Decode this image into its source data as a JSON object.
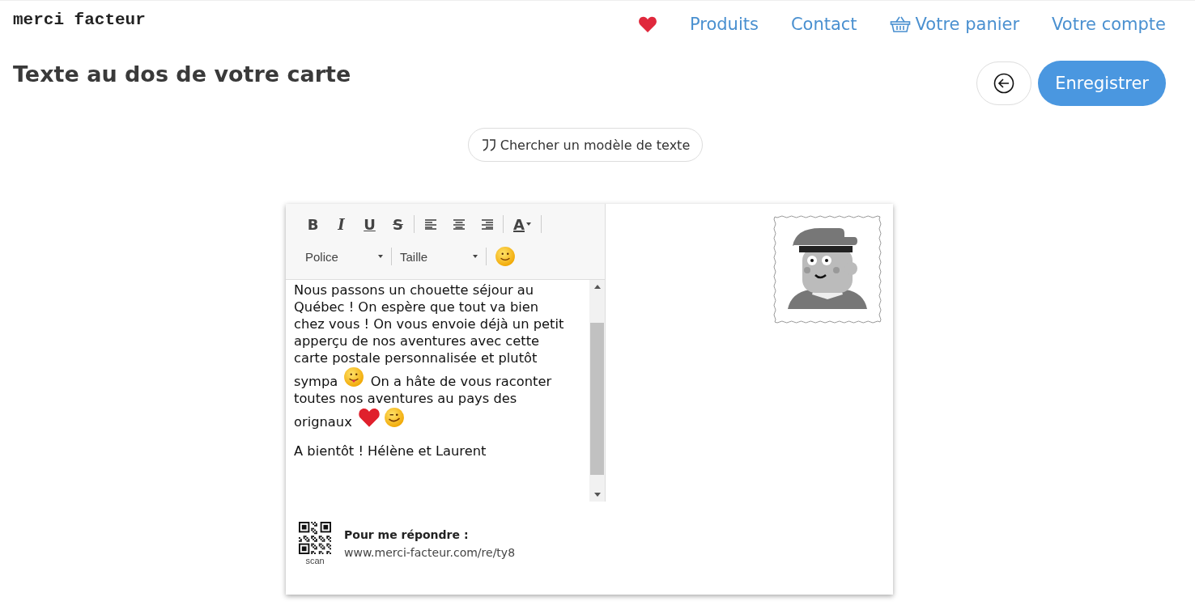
{
  "header": {
    "logo": "merci facteur",
    "nav": [
      {
        "kind": "favorites"
      },
      {
        "kind": "link",
        "label": "Produits"
      },
      {
        "kind": "link",
        "label": "Contact"
      },
      {
        "kind": "cart",
        "label": "Votre panier"
      },
      {
        "kind": "link",
        "label": "Votre compte"
      }
    ]
  },
  "page": {
    "title": "Texte au dos de votre carte",
    "save_button": "Enregistrer",
    "template_button": "Chercher un modèle de texte"
  },
  "editor": {
    "toolbar": [
      {
        "kind": "bold",
        "label": "B"
      },
      {
        "kind": "italic",
        "label": "I"
      },
      {
        "kind": "underline",
        "label": "U"
      },
      {
        "kind": "strike",
        "label": "S"
      },
      {
        "kind": "align-left"
      },
      {
        "kind": "align-center"
      },
      {
        "kind": "align-right"
      },
      {
        "kind": "text-color",
        "label": "A"
      }
    ],
    "font_select": "Police",
    "size_select": "Taille",
    "paragraphs": [
      [
        [
          {
            "kind": "text",
            "text": "Nous passons un chouette séjour au"
          }
        ],
        [
          {
            "kind": "text",
            "text": "Québec ! On espère que tout va bien"
          }
        ],
        [
          {
            "kind": "text",
            "text": "chez vous ! On vous envoie déjà un petit"
          }
        ],
        [
          {
            "kind": "text",
            "text": "apperçu de nos aventures avec cette"
          }
        ],
        [
          {
            "kind": "text",
            "text": "carte postale personnalisée et plutôt"
          }
        ],
        [
          {
            "kind": "text",
            "text": "sympa"
          },
          {
            "kind": "tongue"
          },
          {
            "kind": "text",
            "text": "On a hâte de vous raconter"
          }
        ],
        [
          {
            "kind": "text",
            "text": "toutes nos aventures au pays des"
          }
        ],
        [
          {
            "kind": "text",
            "text": "orignaux"
          },
          {
            "kind": "heart"
          },
          {
            "kind": "wink"
          }
        ]
      ],
      [
        [
          {
            "kind": "text",
            "text": "A bientôt ! Hélène et Laurent"
          }
        ]
      ]
    ]
  },
  "reply": {
    "qr_caption": "scan",
    "label": "Pour me répondre :",
    "url": "www.merci-facteur.com/re/ty8"
  }
}
